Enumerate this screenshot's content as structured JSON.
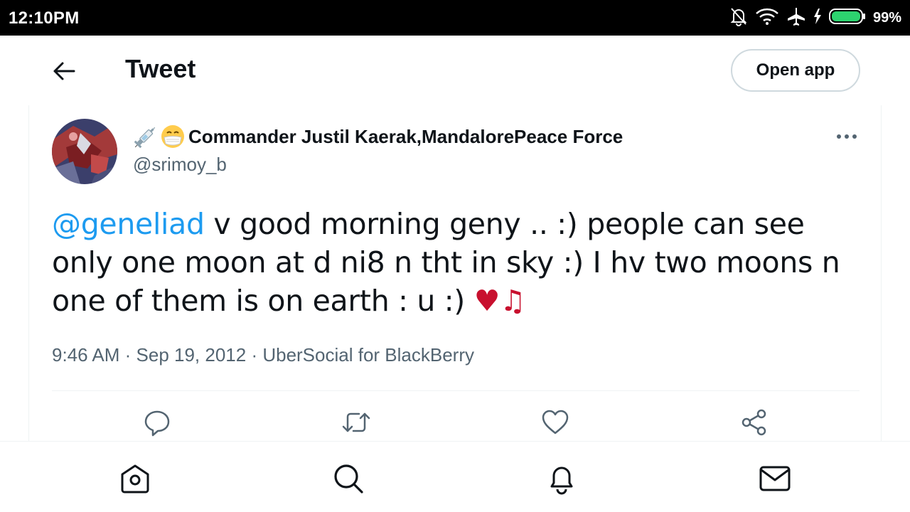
{
  "status_bar": {
    "time": "12:10PM",
    "battery_percent": "99%",
    "icons": [
      "notifications-off-icon",
      "wifi-icon",
      "airplane-mode-icon",
      "charging-icon",
      "battery-icon"
    ]
  },
  "header": {
    "title": "Tweet",
    "open_app_label": "Open app"
  },
  "tweet": {
    "author": {
      "name_emojis": [
        "syringe-emoji",
        "face-with-mask-emoji"
      ],
      "display_name": "Commander Justil Kaerak,MandalorePeace Force",
      "handle": "@srimoy_b"
    },
    "text": {
      "mention": "@geneliad",
      "body": " v good morning geny .. :) people can see only one moon at d ni8 n tht in sky :) I hv two moons n one of them is on earth : u :) ",
      "trailing_emojis": "♥♫"
    },
    "meta": {
      "time": "9:46 AM",
      "separator": " · ",
      "date": "Sep 19, 2012",
      "source": "UberSocial for BlackBerry"
    },
    "actions": [
      "reply-icon",
      "retweet-icon",
      "like-icon",
      "share-icon"
    ]
  },
  "bottom_nav": {
    "items": [
      "home-icon",
      "search-icon",
      "notifications-icon",
      "messages-icon"
    ]
  },
  "colors": {
    "link": "#1d9bf0",
    "text_primary": "#0f1419",
    "text_secondary": "#536471",
    "heart": "#c8102e",
    "border": "#eff3f4"
  }
}
